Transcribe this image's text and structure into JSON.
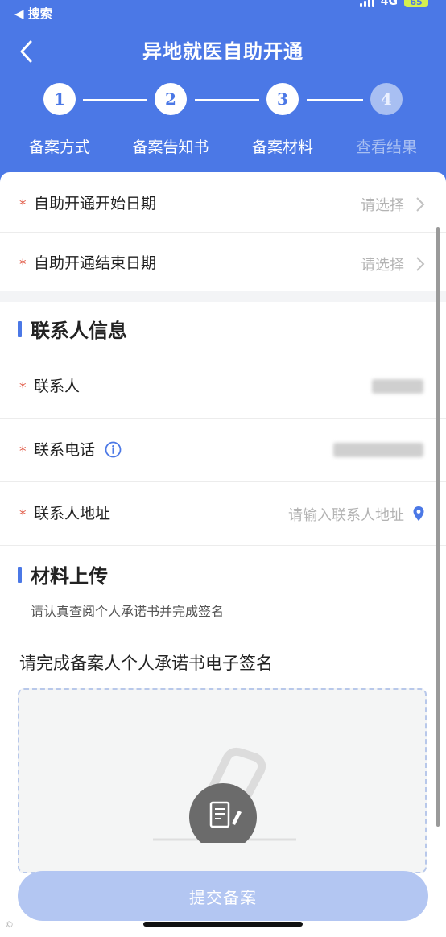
{
  "status_bar": {
    "back_app": "◀ 搜索",
    "network": "4G",
    "battery": "65"
  },
  "header": {
    "title": "异地就医自助开通"
  },
  "steps": [
    {
      "num": "1",
      "label": "备案方式",
      "active": true
    },
    {
      "num": "2",
      "label": "备案告知书",
      "active": true
    },
    {
      "num": "3",
      "label": "备案材料",
      "active": true
    },
    {
      "num": "4",
      "label": "查看结果",
      "active": false
    }
  ],
  "date_fields": [
    {
      "label": "自助开通开始日期",
      "placeholder": "请选择"
    },
    {
      "label": "自助开通结束日期",
      "placeholder": "请选择"
    }
  ],
  "contact_section": {
    "title": "联系人信息",
    "fields": [
      {
        "label": "联系人"
      },
      {
        "label": "联系电话"
      },
      {
        "label": "联系人地址",
        "placeholder": "请输入联系人地址"
      }
    ]
  },
  "upload_section": {
    "title": "材料上传",
    "hint": "请认真查阅个人承诺书并完成签名",
    "sign_title": "请完成备案人个人承诺书电子签名"
  },
  "submit_label": "提交备案",
  "colors": {
    "primary": "#4b78e6",
    "required": "#e0533f",
    "placeholder": "#b3b3b3"
  }
}
